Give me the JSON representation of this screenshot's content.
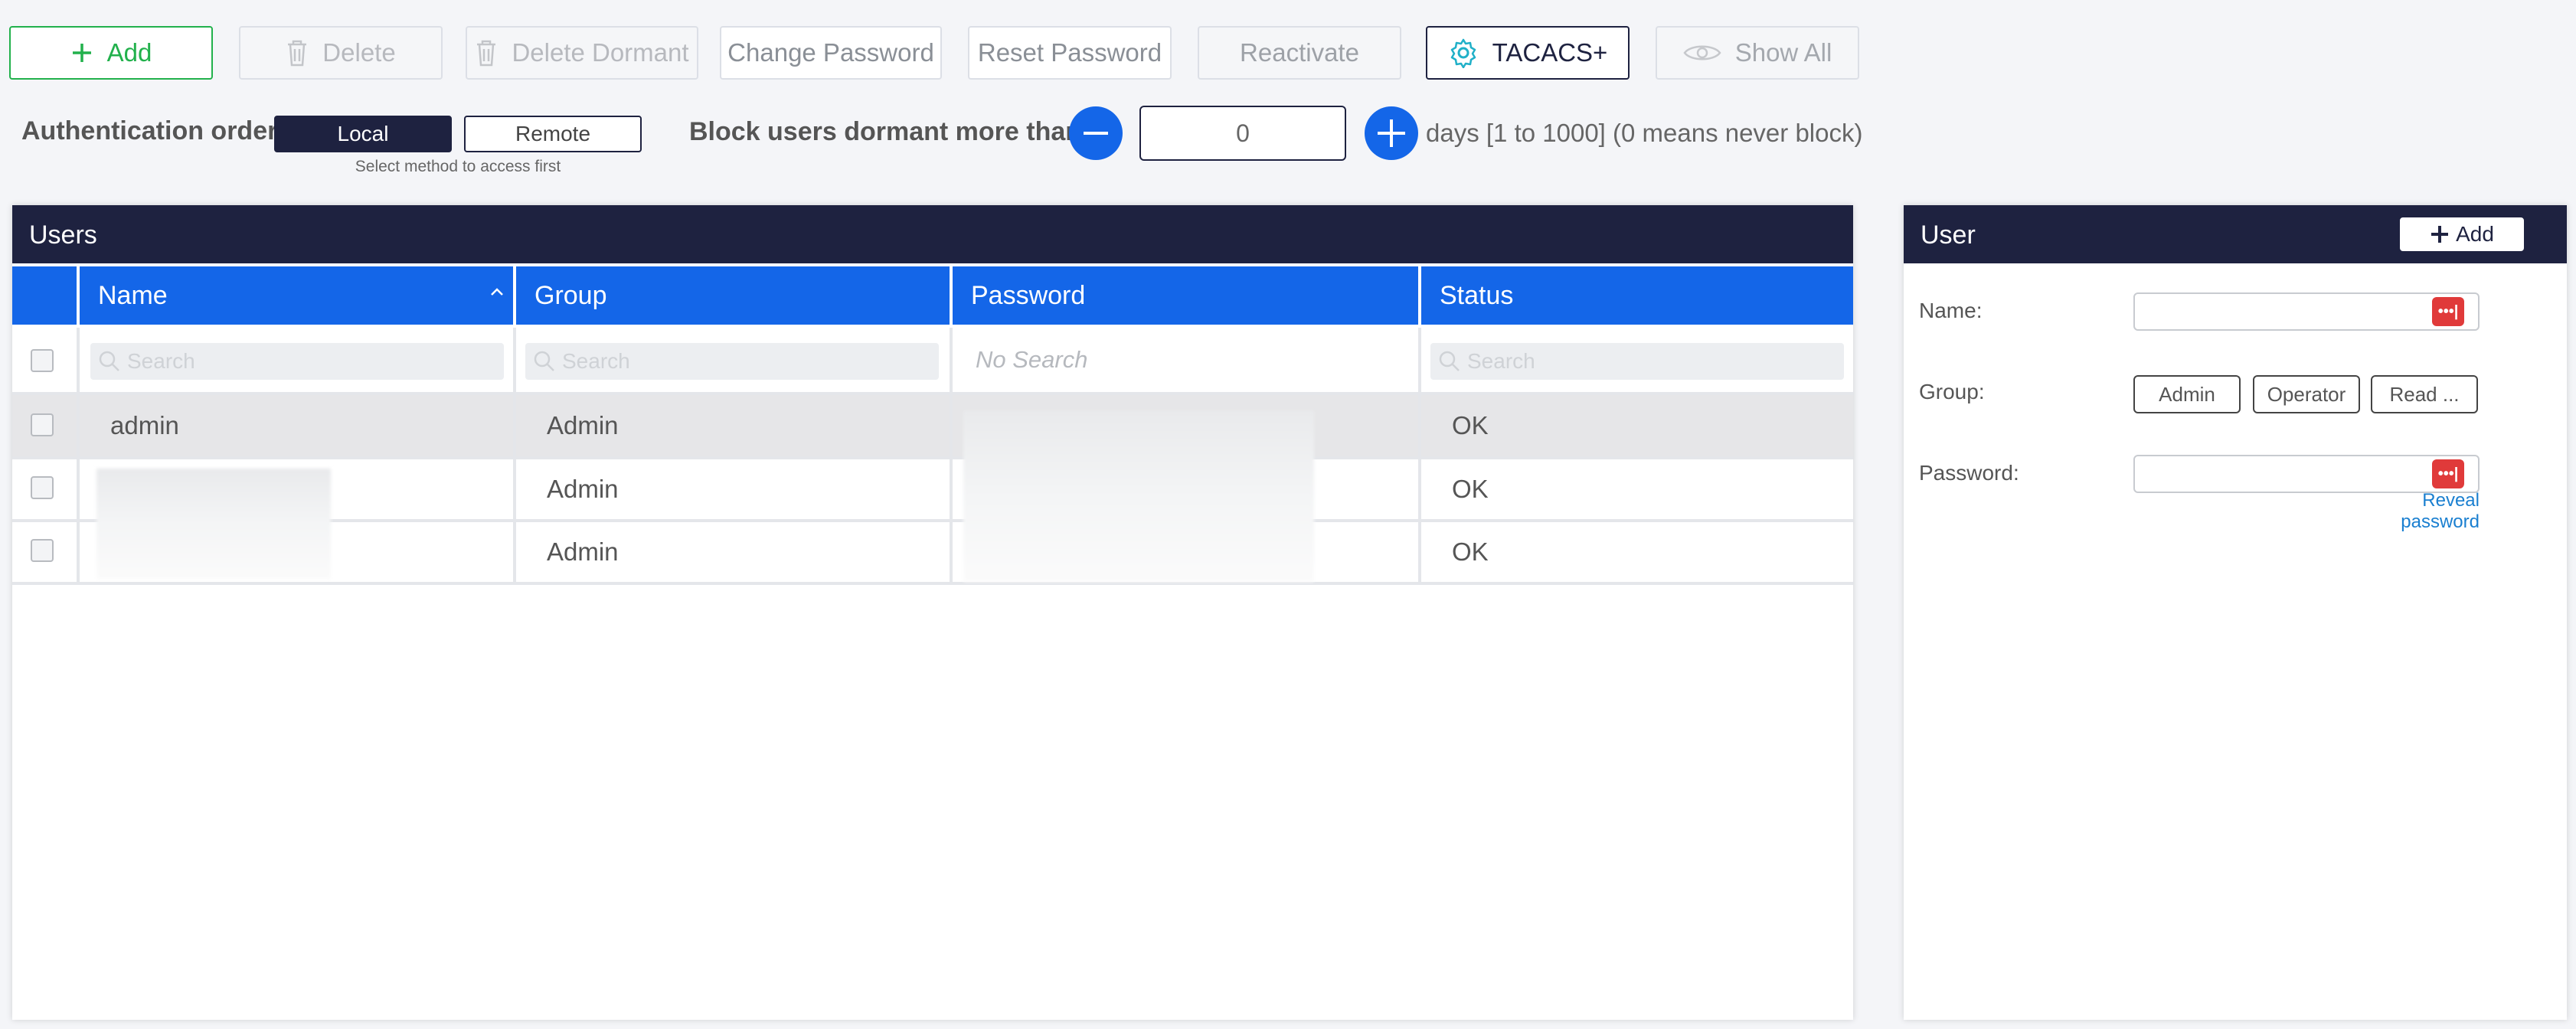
{
  "toolbar": {
    "add": "Add",
    "delete": "Delete",
    "delete_dormant": "Delete Dormant",
    "change_password": "Change Password",
    "reset_password": "Reset Password",
    "reactivate": "Reactivate",
    "tacacs": "TACACS+",
    "show_all": "Show All"
  },
  "auth": {
    "label": "Authentication order",
    "local": "Local",
    "remote": "Remote",
    "hint": "Select method to access first"
  },
  "dormant": {
    "label": "Block users dormant more than",
    "value": "0",
    "hint": "days [1 to 1000] (0 means never block)"
  },
  "users_panel": {
    "title": "Users",
    "columns": [
      "Name",
      "Group",
      "Password",
      "Status"
    ],
    "search_placeholder": "Search",
    "no_search": "No Search",
    "rows": [
      {
        "name": "admin",
        "group": "Admin",
        "status": "OK"
      },
      {
        "name": "",
        "group": "Admin",
        "status": "OK"
      },
      {
        "name": "",
        "group": "Admin",
        "status": "OK"
      }
    ]
  },
  "user_panel": {
    "title": "User",
    "add": "Add",
    "name_label": "Name:",
    "group_label": "Group:",
    "password_label": "Password:",
    "groups": [
      "Admin",
      "Operator",
      "Read ..."
    ],
    "reveal": "Reveal password",
    "dots": "•••|"
  },
  "colors": {
    "navy": "#1e2240",
    "blue": "#1466e8",
    "green": "#22b14c",
    "red": "#e03a3a"
  }
}
